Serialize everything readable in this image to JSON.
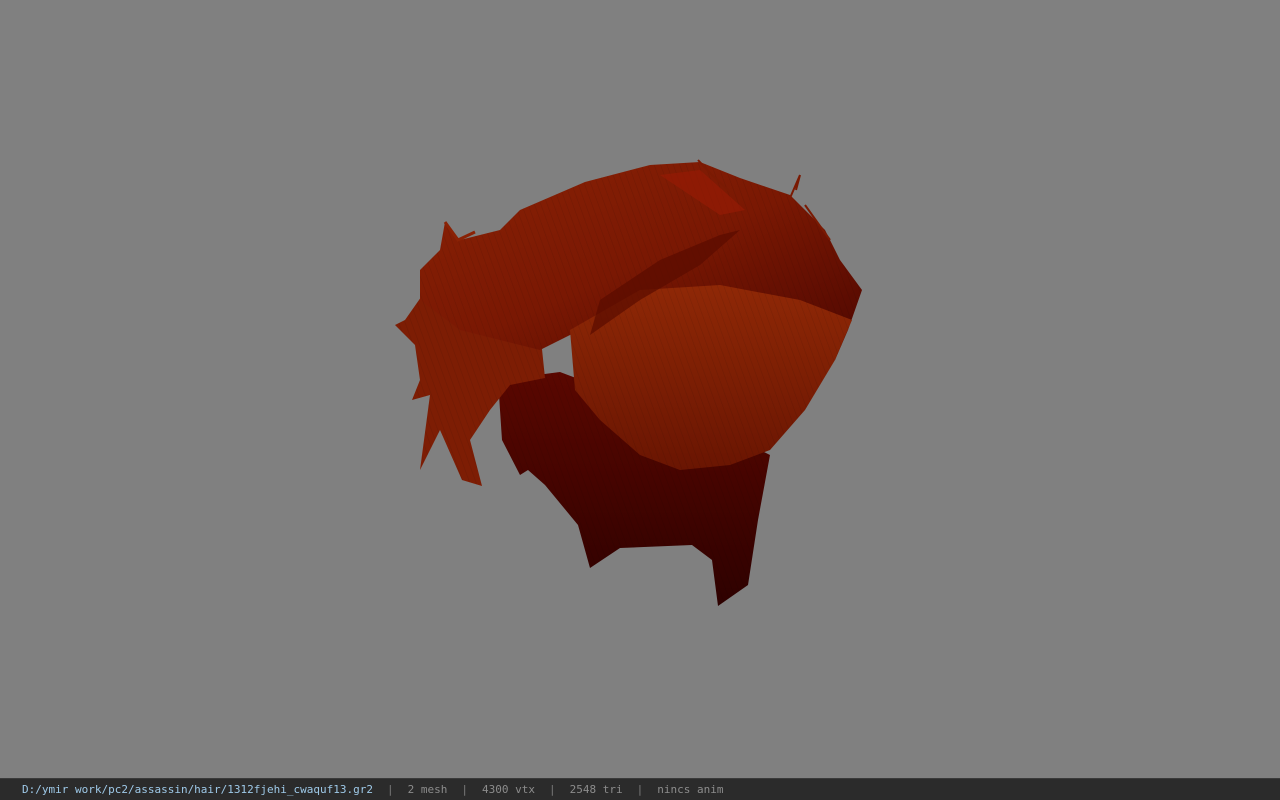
{
  "viewport": {
    "background": "#808080",
    "model_name": "hair mesh",
    "model_colors": {
      "dark": "#3d0200",
      "mid": "#6e1200",
      "light": "#9a2c05",
      "highlight": "#b03a0a"
    }
  },
  "status": {
    "file_path": "D:/ymir work/pc2/assassin/hair/1312fjehi_cwaquf13.gr2",
    "sep": "|",
    "mesh": "2 mesh",
    "vtx": "4300 vtx",
    "tri": "2548 tri",
    "anim": "nincs anim"
  }
}
